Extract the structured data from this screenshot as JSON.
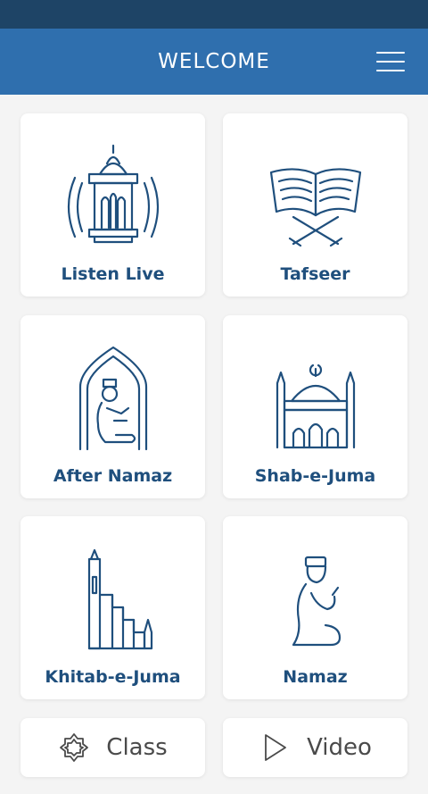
{
  "header": {
    "title": "WELCOME"
  },
  "tiles": [
    {
      "label": "Listen Live",
      "icon": "mosque-lamp-broadcast-icon"
    },
    {
      "label": "Tafseer",
      "icon": "quran-on-stand-icon"
    },
    {
      "label": "After Namaz",
      "icon": "praying-in-mihrab-icon"
    },
    {
      "label": "Shab-e-Juma",
      "icon": "mosque-icon"
    },
    {
      "label": "Khitab-e-Juma",
      "icon": "minbar-icon"
    },
    {
      "label": "Namaz",
      "icon": "praying-man-icon"
    }
  ],
  "buttons": {
    "class": {
      "label": "Class",
      "icon": "star-badge-icon"
    },
    "video": {
      "label": "Video",
      "icon": "play-icon"
    }
  },
  "colors": {
    "status_bar": "#1e4466",
    "header": "#2f6fae",
    "icon_stroke": "#1f4f7d",
    "background": "#f4f4f4"
  }
}
